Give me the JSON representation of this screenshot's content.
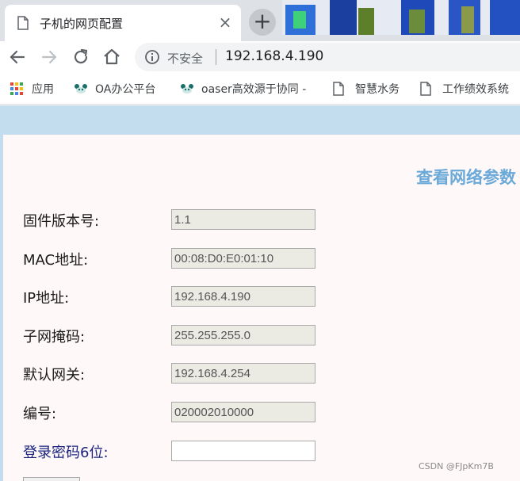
{
  "tab": {
    "title": "子机的网页配置",
    "close": "×",
    "new_tab": "+"
  },
  "omnibox": {
    "security_text": "不安全",
    "url": "192.168.4.190"
  },
  "bookmarks": [
    {
      "label": "应用",
      "icon": "apps-grid-icon"
    },
    {
      "label": "OA办公平台",
      "icon": "panda-icon"
    },
    {
      "label": "oaser高效源于协同 -",
      "icon": "panda-icon"
    },
    {
      "label": "智慧水务",
      "icon": "page-icon"
    },
    {
      "label": "工作绩效系统",
      "icon": "page-icon"
    }
  ],
  "main": {
    "view_link": "查看网络参数",
    "rows": [
      {
        "label": "固件版本号:",
        "value": "1.1"
      },
      {
        "label": "MAC地址:",
        "value": "00:08:D0:E0:01:10"
      },
      {
        "label": "IP地址:",
        "value": "192.168.4.190"
      },
      {
        "label": "子网掩码:",
        "value": "255.255.255.0"
      },
      {
        "label": "默认网关:",
        "value": "192.168.4.254"
      },
      {
        "label": "编号:",
        "value": "020002010000"
      },
      {
        "label": "登录密码6位:",
        "value": ""
      }
    ]
  },
  "watermark": "CSDN @FJpKm7B",
  "colors": {
    "tab_strip": "#dee1e6",
    "page_bg": "#c3ddef",
    "panel_bg": "#fff8f8",
    "link": "#6aa9d8",
    "password_label": "#1a237e"
  }
}
